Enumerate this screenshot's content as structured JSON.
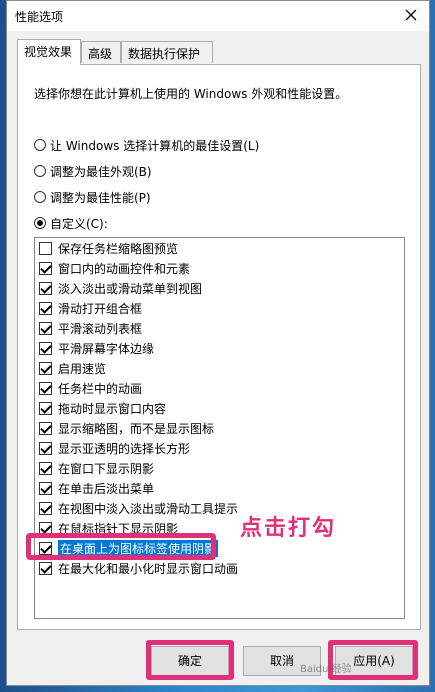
{
  "window": {
    "title": "性能选项"
  },
  "tabs": [
    "视觉效果",
    "高级",
    "数据执行保护"
  ],
  "description": "选择你想在此计算机上使用的 Windows 外观和性能设置。",
  "options": [
    {
      "label": "让 Windows 选择计算机的最佳设置(L)",
      "selected": false
    },
    {
      "label": "调整为最佳外观(B)",
      "selected": false
    },
    {
      "label": "调整为最佳性能(P)",
      "selected": false
    },
    {
      "label": "自定义(C):",
      "selected": true
    }
  ],
  "effects": [
    {
      "label": "保存任务栏缩略图预览",
      "checked": false
    },
    {
      "label": "窗口内的动画控件和元素",
      "checked": true
    },
    {
      "label": "淡入淡出或滑动菜单到视图",
      "checked": true
    },
    {
      "label": "滑动打开组合框",
      "checked": true
    },
    {
      "label": "平滑滚动列表框",
      "checked": true
    },
    {
      "label": "平滑屏幕字体边缘",
      "checked": true
    },
    {
      "label": "启用速览",
      "checked": true
    },
    {
      "label": "任务栏中的动画",
      "checked": true
    },
    {
      "label": "拖动时显示窗口内容",
      "checked": true
    },
    {
      "label": "显示缩略图，而不是显示图标",
      "checked": true
    },
    {
      "label": "显示亚透明的选择长方形",
      "checked": true
    },
    {
      "label": "在窗口下显示阴影",
      "checked": true
    },
    {
      "label": "在单击后淡出菜单",
      "checked": true
    },
    {
      "label": "在视图中淡入淡出或滑动工具提示",
      "checked": true
    },
    {
      "label": "在鼠标指针下显示阴影",
      "checked": true
    },
    {
      "label": "在桌面上为图标标签使用阴影",
      "checked": true,
      "selected": true
    },
    {
      "label": "在最大化和最小化时显示窗口动画",
      "checked": true
    }
  ],
  "annotation": "点击打勾",
  "buttons": {
    "ok": "确定",
    "cancel": "取消",
    "apply": "应用(A)"
  },
  "watermark": "Baidu 经验",
  "colors": {
    "highlight": "#e0307a",
    "selection": "#0078d7"
  }
}
